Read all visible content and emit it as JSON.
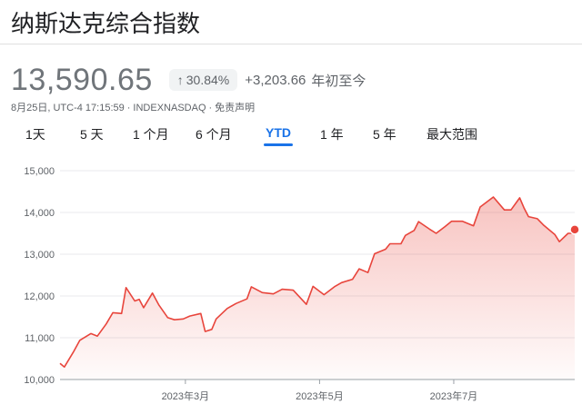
{
  "header": {
    "title": "纳斯达克综合指数"
  },
  "quote": {
    "price": "13,590.65",
    "change_percent": "30.84%",
    "change_abs": "+3,203.66",
    "change_label": "年初至今",
    "date": "8月25日",
    "time": "UTC-4 17:15:59",
    "exchange": "INDEXNASDAQ",
    "disclaimer": "免责声明"
  },
  "tabs": [
    {
      "label": "1天"
    },
    {
      "label": "5 天"
    },
    {
      "label": "1 个月"
    },
    {
      "label": "6 个月"
    },
    {
      "label": "YTD"
    },
    {
      "label": "1 年"
    },
    {
      "label": "5 年"
    },
    {
      "label": "最大范围"
    }
  ],
  "colors": {
    "line": "#e8453c",
    "accent": "#1a73e8",
    "text_muted": "#70757a"
  },
  "chart_data": {
    "type": "area",
    "ylim": [
      10000,
      15000
    ],
    "yticks": [
      "10,000",
      "11,000",
      "12,000",
      "13,000",
      "14,000",
      "15,000"
    ],
    "xlim": [
      "2023-01-03",
      "2023-08-25"
    ],
    "xticks": [
      {
        "date": "2023-03-01",
        "label": "2023年3月"
      },
      {
        "date": "2023-05-01",
        "label": "2023年5月"
      },
      {
        "date": "2023-07-01",
        "label": "2023年7月"
      }
    ],
    "x": [
      "2023-01-03",
      "2023-01-05",
      "2023-01-09",
      "2023-01-12",
      "2023-01-17",
      "2023-01-20",
      "2023-01-24",
      "2023-01-27",
      "2023-01-31",
      "2023-02-02",
      "2023-02-06",
      "2023-02-08",
      "2023-02-10",
      "2023-02-14",
      "2023-02-17",
      "2023-02-21",
      "2023-02-24",
      "2023-02-28",
      "2023-03-03",
      "2023-03-08",
      "2023-03-10",
      "2023-03-13",
      "2023-03-15",
      "2023-03-20",
      "2023-03-24",
      "2023-03-29",
      "2023-03-31",
      "2023-04-05",
      "2023-04-10",
      "2023-04-14",
      "2023-04-19",
      "2023-04-25",
      "2023-04-28",
      "2023-05-03",
      "2023-05-08",
      "2023-05-11",
      "2023-05-16",
      "2023-05-19",
      "2023-05-23",
      "2023-05-26",
      "2023-05-31",
      "2023-06-02",
      "2023-06-07",
      "2023-06-09",
      "2023-06-13",
      "2023-06-15",
      "2023-06-20",
      "2023-06-23",
      "2023-06-27",
      "2023-06-30",
      "2023-07-05",
      "2023-07-10",
      "2023-07-13",
      "2023-07-19",
      "2023-07-24",
      "2023-07-27",
      "2023-07-31",
      "2023-08-02",
      "2023-08-04",
      "2023-08-08",
      "2023-08-11",
      "2023-08-16",
      "2023-08-18",
      "2023-08-22",
      "2023-08-24",
      "2023-08-25"
    ],
    "values": [
      10386,
      10300,
      10650,
      10940,
      11100,
      11040,
      11330,
      11600,
      11580,
      12200,
      11880,
      11920,
      11720,
      12070,
      11780,
      11480,
      11430,
      11450,
      11520,
      11580,
      11150,
      11200,
      11450,
      11700,
      11820,
      11930,
      12220,
      12080,
      12050,
      12160,
      12140,
      11800,
      12230,
      12030,
      12230,
      12320,
      12400,
      12650,
      12560,
      13010,
      13120,
      13250,
      13250,
      13450,
      13570,
      13780,
      13600,
      13500,
      13660,
      13790,
      13790,
      13680,
      14130,
      14370,
      14060,
      14060,
      14350,
      14100,
      13900,
      13850,
      13690,
      13470,
      13300,
      13500,
      13500,
      13590
    ]
  }
}
